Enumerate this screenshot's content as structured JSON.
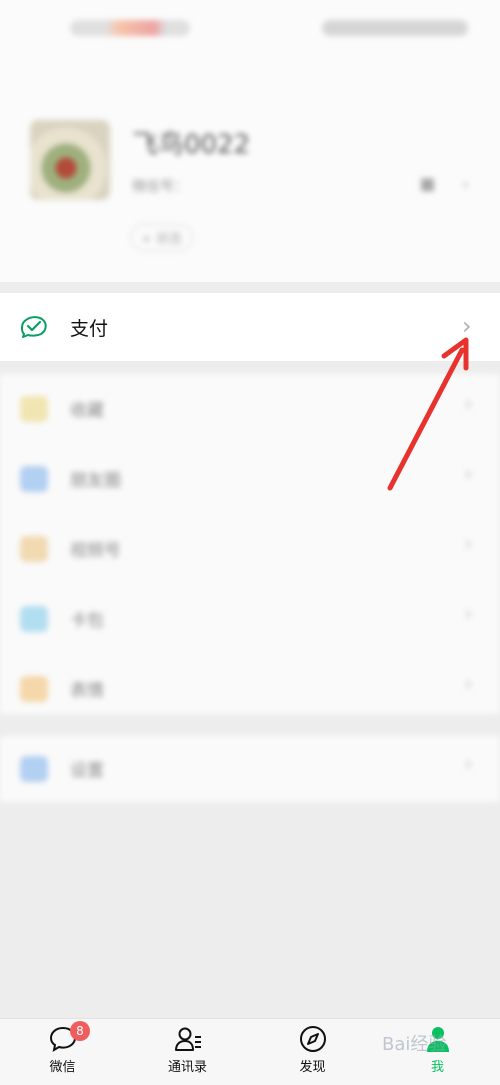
{
  "status_bar": {
    "left_text": "",
    "right_text": ""
  },
  "profile": {
    "name": "飞鸟0022",
    "wechat_id": "微信号：",
    "status_label": "+ 状态"
  },
  "pay_row": {
    "label": "支付"
  },
  "menu": {
    "items": [
      {
        "label": "收藏",
        "icon_color": "#e8cf6a"
      },
      {
        "label": "朋友圈",
        "icon_color": "#6aa6e8"
      },
      {
        "label": "视频号",
        "icon_color": "#e8b96a"
      },
      {
        "label": "卡包",
        "icon_color": "#6ac2e8"
      },
      {
        "label": "表情",
        "icon_color": "#f0b35a"
      }
    ],
    "settings": {
      "label": "设置",
      "icon_color": "#6aa6e8"
    }
  },
  "tabbar": {
    "tabs": [
      {
        "label": "微信",
        "badge": "8",
        "icon": "chat-bubble-icon"
      },
      {
        "label": "通讯录",
        "icon": "contacts-icon"
      },
      {
        "label": "发现",
        "icon": "compass-icon"
      },
      {
        "label": "我",
        "icon": "person-icon",
        "active": true
      }
    ]
  },
  "watermark": {
    "text": "Bai经验"
  },
  "colors": {
    "accent_green": "#07c160",
    "annotation_red": "#e8322e",
    "badge_red": "#f15d5d"
  }
}
